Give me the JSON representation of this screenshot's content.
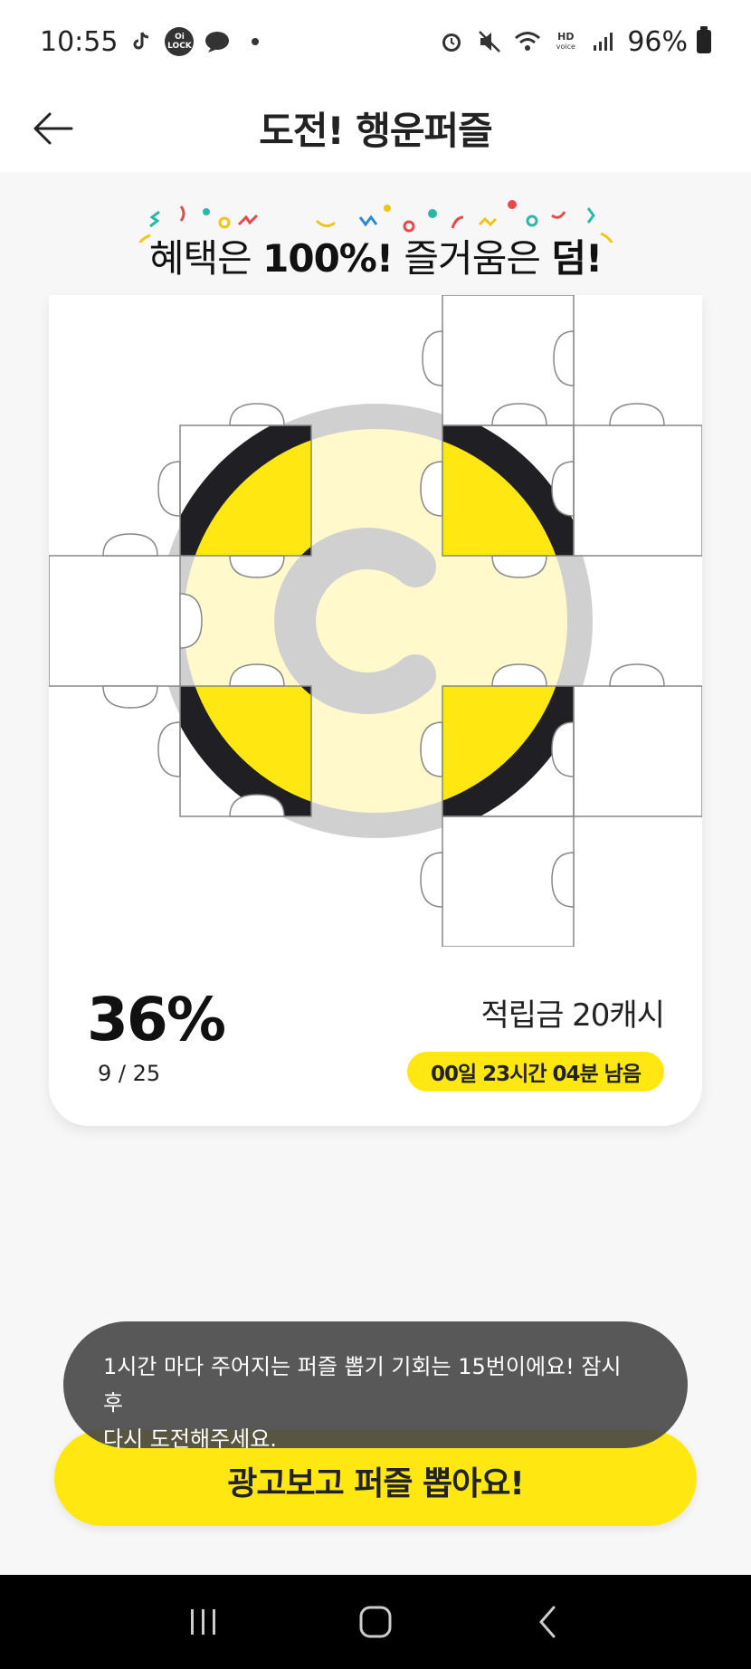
{
  "status_bar": {
    "time": "10:55",
    "battery_percent": "96%",
    "left_icons": [
      "tiktok-icon",
      "oi-lock-icon",
      "chat-icon",
      "dot-icon"
    ],
    "right_icons": [
      "alarm-icon",
      "mute-icon",
      "wifi-icon",
      "hd-voice-icon",
      "signal-icon",
      "battery-icon"
    ],
    "oi_lock_label": "Oi LOCK",
    "hd_label": "HD",
    "voice_label": "voice"
  },
  "header": {
    "title": "도전! 행운퍼즐"
  },
  "banner": {
    "text_prefix": "혜택은 ",
    "text_bold1": "100%!",
    "text_middle": " 즐거움은 ",
    "text_bold2": "덤!"
  },
  "puzzle": {
    "collected": 9,
    "total": 25,
    "logo_letter": "C",
    "colors": {
      "accent": "#ffe812",
      "dark": "#1f1f24",
      "faded_yellow": "#fff9cc",
      "faded_gray": "#d0d0d0"
    }
  },
  "progress": {
    "percent": "36%",
    "count": "9 / 25"
  },
  "reward": {
    "text": "적립금 20캐시"
  },
  "timer": {
    "text": "00일 23시간 04분 남음"
  },
  "toast": {
    "line1": "1시간 마다 주어지는 퍼즐 뽑기 기회는 15번이에요! 잠시 후",
    "line2": "다시 도전해주세요."
  },
  "cta": {
    "label": "광고보고 퍼즐 뽑아요!"
  },
  "nav": {
    "icons": [
      "recent-apps-icon",
      "home-icon",
      "back-nav-icon"
    ]
  }
}
